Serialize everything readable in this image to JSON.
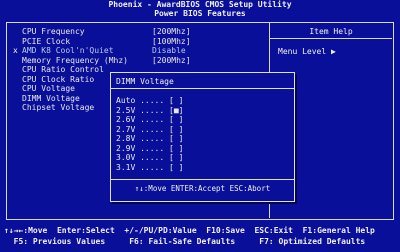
{
  "header": {
    "line1": "Phoenix - AwardBIOS CMOS Setup Utility",
    "line2": "Power BIOS Features"
  },
  "help": {
    "title": "Item Help",
    "text": "Menu Level  ▶"
  },
  "menu": {
    "items": [
      {
        "label": "CPU Frequency",
        "value": "[200Mhz]",
        "marker": ""
      },
      {
        "label": "PCIE Clock",
        "value": "[100Mhz]",
        "marker": ""
      },
      {
        "label": "AMD K8 Cool'n'Quiet",
        "value": "Disable",
        "marker": "x",
        "dim": true
      },
      {
        "label": "Memory Frequency (Mhz)",
        "value": "[200Mhz]",
        "marker": ""
      },
      {
        "label": "CPU Ratio Control",
        "value": "",
        "marker": ""
      },
      {
        "label": "CPU Clock Ratio",
        "value": "",
        "marker": ""
      },
      {
        "label": "CPU Voltage",
        "value": "",
        "marker": ""
      },
      {
        "label": "DIMM Voltage",
        "value": "",
        "marker": ""
      },
      {
        "label": "Chipset Voltage",
        "value": "",
        "marker": ""
      }
    ]
  },
  "popup": {
    "title": "DIMM Voltage",
    "options": [
      {
        "label": "Auto",
        "dots": " .....",
        "check": "[ ]"
      },
      {
        "label": "2.5V",
        "dots": " .....",
        "check": "[■]"
      },
      {
        "label": "2.6V",
        "dots": " .....",
        "check": "[ ]"
      },
      {
        "label": "2.7V",
        "dots": " .....",
        "check": "[ ]"
      },
      {
        "label": "2.8V",
        "dots": " .....",
        "check": "[ ]"
      },
      {
        "label": "2.9V",
        "dots": " .....",
        "check": "[ ]"
      },
      {
        "label": "3.0V",
        "dots": " .....",
        "check": "[ ]"
      },
      {
        "label": "3.1V",
        "dots": " .....",
        "check": "[ ]"
      }
    ],
    "footer": "↑↓:Move ENTER:Accept ESC:Abort"
  },
  "footer": {
    "line1": "↑↓→←:Move  Enter:Select  +/-/PU/PD:Value  F10:Save  ESC:Exit  F1:General Help",
    "line2": "  F5: Previous Values     F6: Fail-Safe Defaults     F7: Optimized Defaults"
  }
}
